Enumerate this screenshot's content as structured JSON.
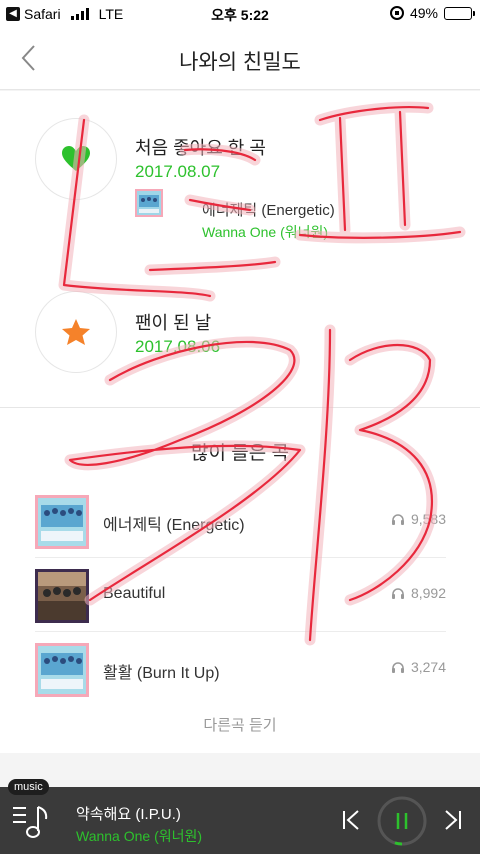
{
  "status_bar": {
    "back_app": "Safari",
    "network": "LTE",
    "time": "오후 5:22",
    "battery_percent": "49%",
    "battery_level": 0.49
  },
  "header": {
    "title": "나와의 친밀도",
    "back_icon": "chevron-left-icon"
  },
  "milestones": [
    {
      "icon": "heart-icon",
      "label": "처음 좋아요 한 곡",
      "date": "2017.08.07",
      "song": {
        "title": "에너제틱 (Energetic)",
        "artist": "Wanna One (워너원)"
      }
    },
    {
      "icon": "star-icon",
      "label": "팬이 된 날",
      "date": "2017.08.06"
    }
  ],
  "most_played": {
    "title": "많이 들은 곡",
    "tracks": [
      {
        "title": "에너제틱 (Energetic)",
        "plays": "9,583"
      },
      {
        "title": "Beautiful",
        "plays": "8,992"
      },
      {
        "title": "활활 (Burn It Up)",
        "plays": "3,274"
      }
    ],
    "more_label": "다른곡 듣기"
  },
  "player": {
    "tag": "music",
    "title": "약속해요 (I.P.U.)",
    "artist": "Wanna One (워너원)",
    "progress": 0.05
  },
  "colors": {
    "accent_green": "#2dc12d",
    "star_orange": "#f5822a",
    "overlay_red": "#e8283c"
  }
}
